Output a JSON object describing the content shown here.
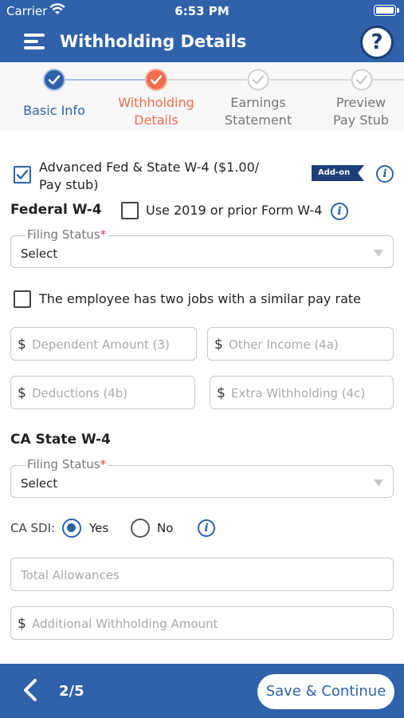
{
  "status_bar": {
    "carrier": "Carrier",
    "time": "6:53 PM"
  },
  "header": {
    "title": "Withholding Details",
    "help_label": "?"
  },
  "stepper": {
    "steps": [
      {
        "label": "Basic Info",
        "state": "completed"
      },
      {
        "label_line1": "Withholding",
        "label_line2": "Details",
        "state": "current"
      },
      {
        "label_line1": "Earnings",
        "label_line2": "Statement",
        "state": "pending"
      },
      {
        "label_line1": "Preview",
        "label_line2": "Pay Stub",
        "state": "pending"
      }
    ]
  },
  "addon": {
    "checked": true,
    "label_line1": "Advanced Fed & State W-4 ($1.00/",
    "label_line2": "Pay stub)",
    "badge": "Add-on"
  },
  "federal": {
    "title": "Federal W-4",
    "prior_form_label": "Use 2019 or prior Form W-4",
    "prior_form_checked": false,
    "filing_status_label": "Filing Status",
    "filing_status_required": "*",
    "filing_status_value": "Select",
    "two_jobs_label": "The employee has two jobs with a similar pay rate",
    "two_jobs_checked": false,
    "currency_symbol": "$",
    "dependent_amount_placeholder": "Dependent Amount (3)",
    "other_income_placeholder": "Other Income (4a)",
    "deductions_placeholder": "Deductions (4b)",
    "extra_withholding_placeholder": "Extra Withholding (4c)"
  },
  "state": {
    "title": "CA State W-4",
    "filing_status_label": "Filing Status",
    "filing_status_required": "*",
    "filing_status_value": "Select",
    "sdi_label": "CA SDI:",
    "sdi_yes": "Yes",
    "sdi_no": "No",
    "sdi_selected": "Yes",
    "total_allowances_placeholder": "Total Allowances",
    "currency_symbol": "$",
    "additional_withholding_placeholder": "Additional Withholding Amount"
  },
  "footer": {
    "page_indicator": "2/5",
    "save_label": "Save & Continue"
  },
  "colors": {
    "primary": "#2f62aa",
    "dark_primary": "#1d3f78",
    "accent_orange": "#ef6c4d",
    "required": "#e2403a"
  },
  "icons": [
    "wifi-icon",
    "battery-icon",
    "menu-icon",
    "help-icon",
    "check-icon",
    "info-icon",
    "dropdown-caret-icon",
    "chevron-left-icon"
  ]
}
